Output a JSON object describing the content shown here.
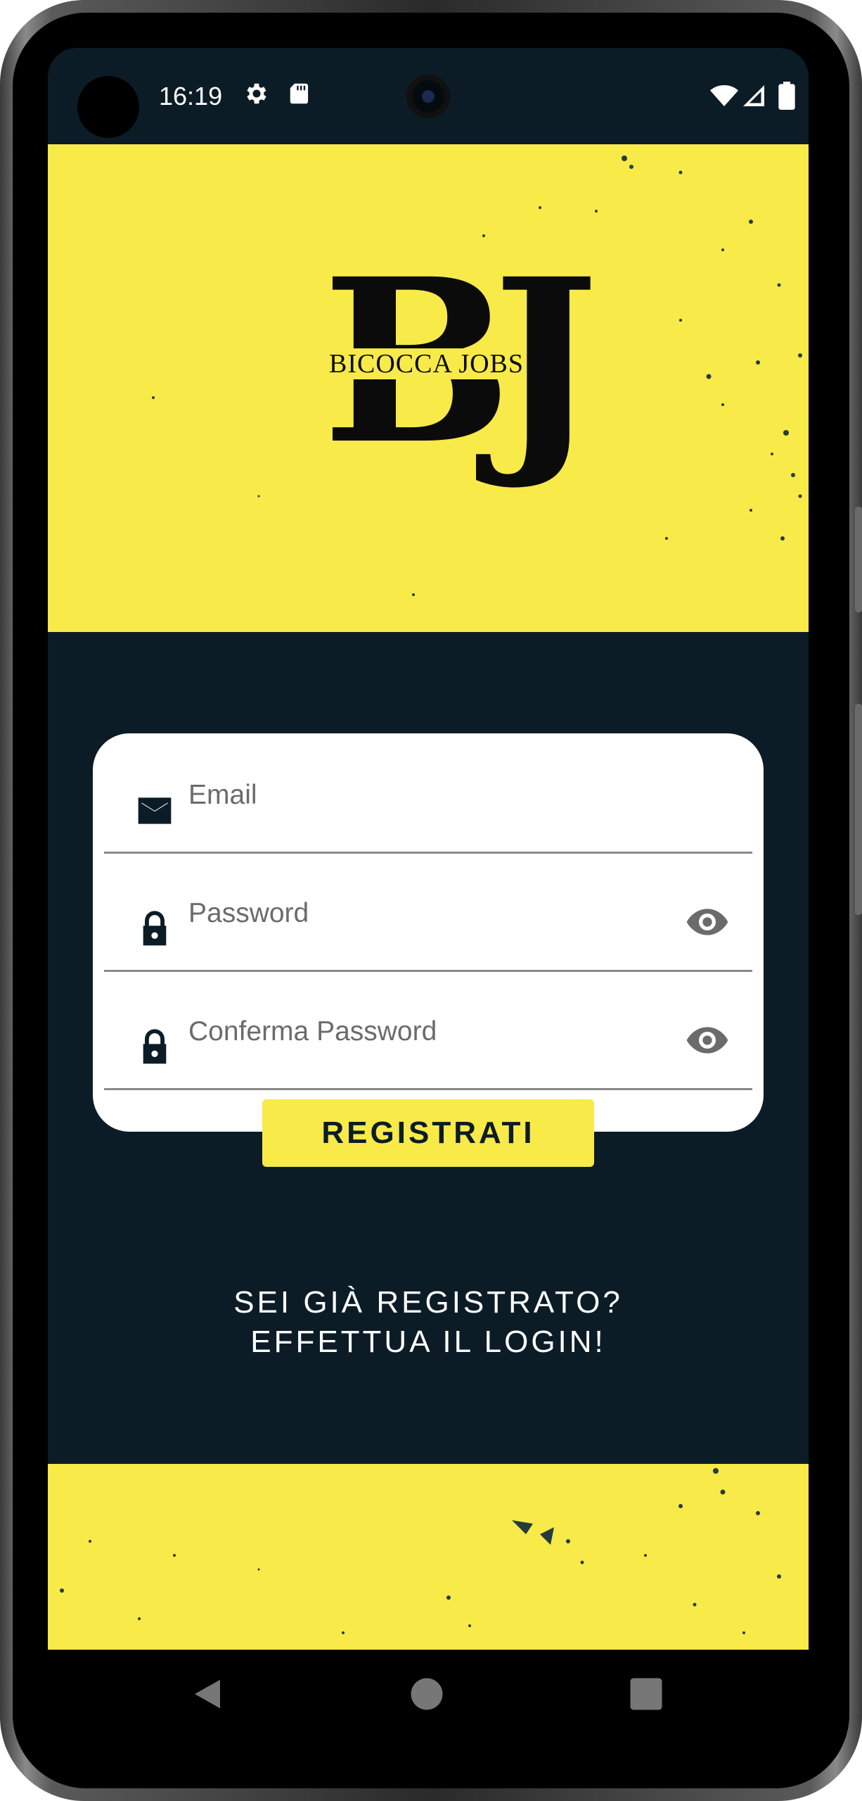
{
  "status_bar": {
    "time": "16:19",
    "left_icons": [
      "gear-icon",
      "sd-card-icon"
    ],
    "right_icons": [
      "wifi-icon",
      "signal-icon",
      "battery-icon"
    ]
  },
  "logo": {
    "letters": "BJ",
    "subtitle": "BICOCCA JOBS"
  },
  "form": {
    "email": {
      "placeholder": "Email",
      "icon": "mail-icon"
    },
    "password": {
      "placeholder": "Password",
      "icon": "lock-icon",
      "toggle_icon": "eye-icon"
    },
    "confirm_password": {
      "placeholder": "Conferma Password",
      "icon": "lock-icon",
      "toggle_icon": "eye-icon"
    },
    "submit_label": "REGISTRATI"
  },
  "login_prompt": {
    "line1": "SEI GIÀ REGISTRATO?",
    "line2": "EFFETTUA IL LOGIN!"
  },
  "nav_bar": {
    "buttons": [
      "back-icon",
      "home-icon",
      "recents-icon"
    ]
  },
  "colors": {
    "accent_yellow": "#f8ea48",
    "background_dark": "#0c1c26",
    "card": "#ffffff",
    "placeholder_text": "#6b6b6b"
  }
}
